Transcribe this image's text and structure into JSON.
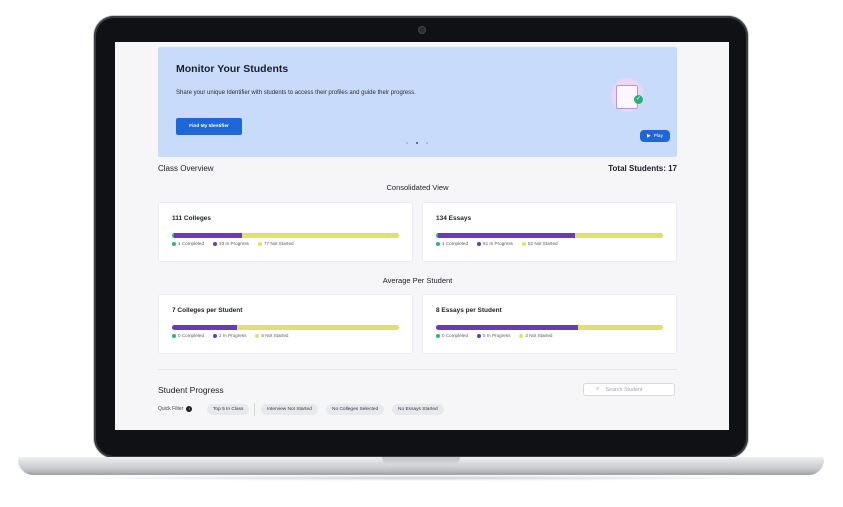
{
  "banner": {
    "title": "Monitor Your Students",
    "description": "Share your unique Identifier with students to access their profiles and guide their progress.",
    "button_label": "Find My Identifier",
    "play_label": "Play"
  },
  "overview": {
    "heading": "Class Overview",
    "total_students": "Total Students: 17",
    "consolidated_title": "Consolidated View",
    "average_title": "Average Per Student"
  },
  "cards": {
    "colleges_total": {
      "title": "111 Colleges",
      "completed": 1,
      "in_progress": 33,
      "not_started": 77,
      "legend": [
        "1 Completed",
        "33 In Progress",
        "77 Not Started"
      ]
    },
    "essays_total": {
      "title": "134 Essays",
      "completed": 1,
      "in_progress": 81,
      "not_started": 52,
      "legend": [
        "1 Completed",
        "81 In Progress",
        "52 Not Started"
      ]
    },
    "colleges_avg": {
      "title": "7 Colleges per Student",
      "completed": 0,
      "in_progress": 2,
      "not_started": 5,
      "legend": [
        "0 Completed",
        "2 In Progress",
        "5 Not Started"
      ]
    },
    "essays_avg": {
      "title": "8 Essays per Student",
      "completed": 0,
      "in_progress": 5,
      "not_started": 3,
      "legend": [
        "0 Completed",
        "5 In Progress",
        "3 Not Started"
      ]
    }
  },
  "student_progress": {
    "title": "Student Progress",
    "search_placeholder": "Search Student",
    "quick_filter_label": "Quick Filter",
    "filters": [
      "Top 5 In Class",
      "Interview Not Started",
      "No Colleges Selected",
      "No Essays Started"
    ]
  },
  "colors": {
    "completed": "#2bb386",
    "in_progress": "#6a3bb8",
    "not_started": "#e1e06b",
    "accent": "#1f67d6"
  }
}
